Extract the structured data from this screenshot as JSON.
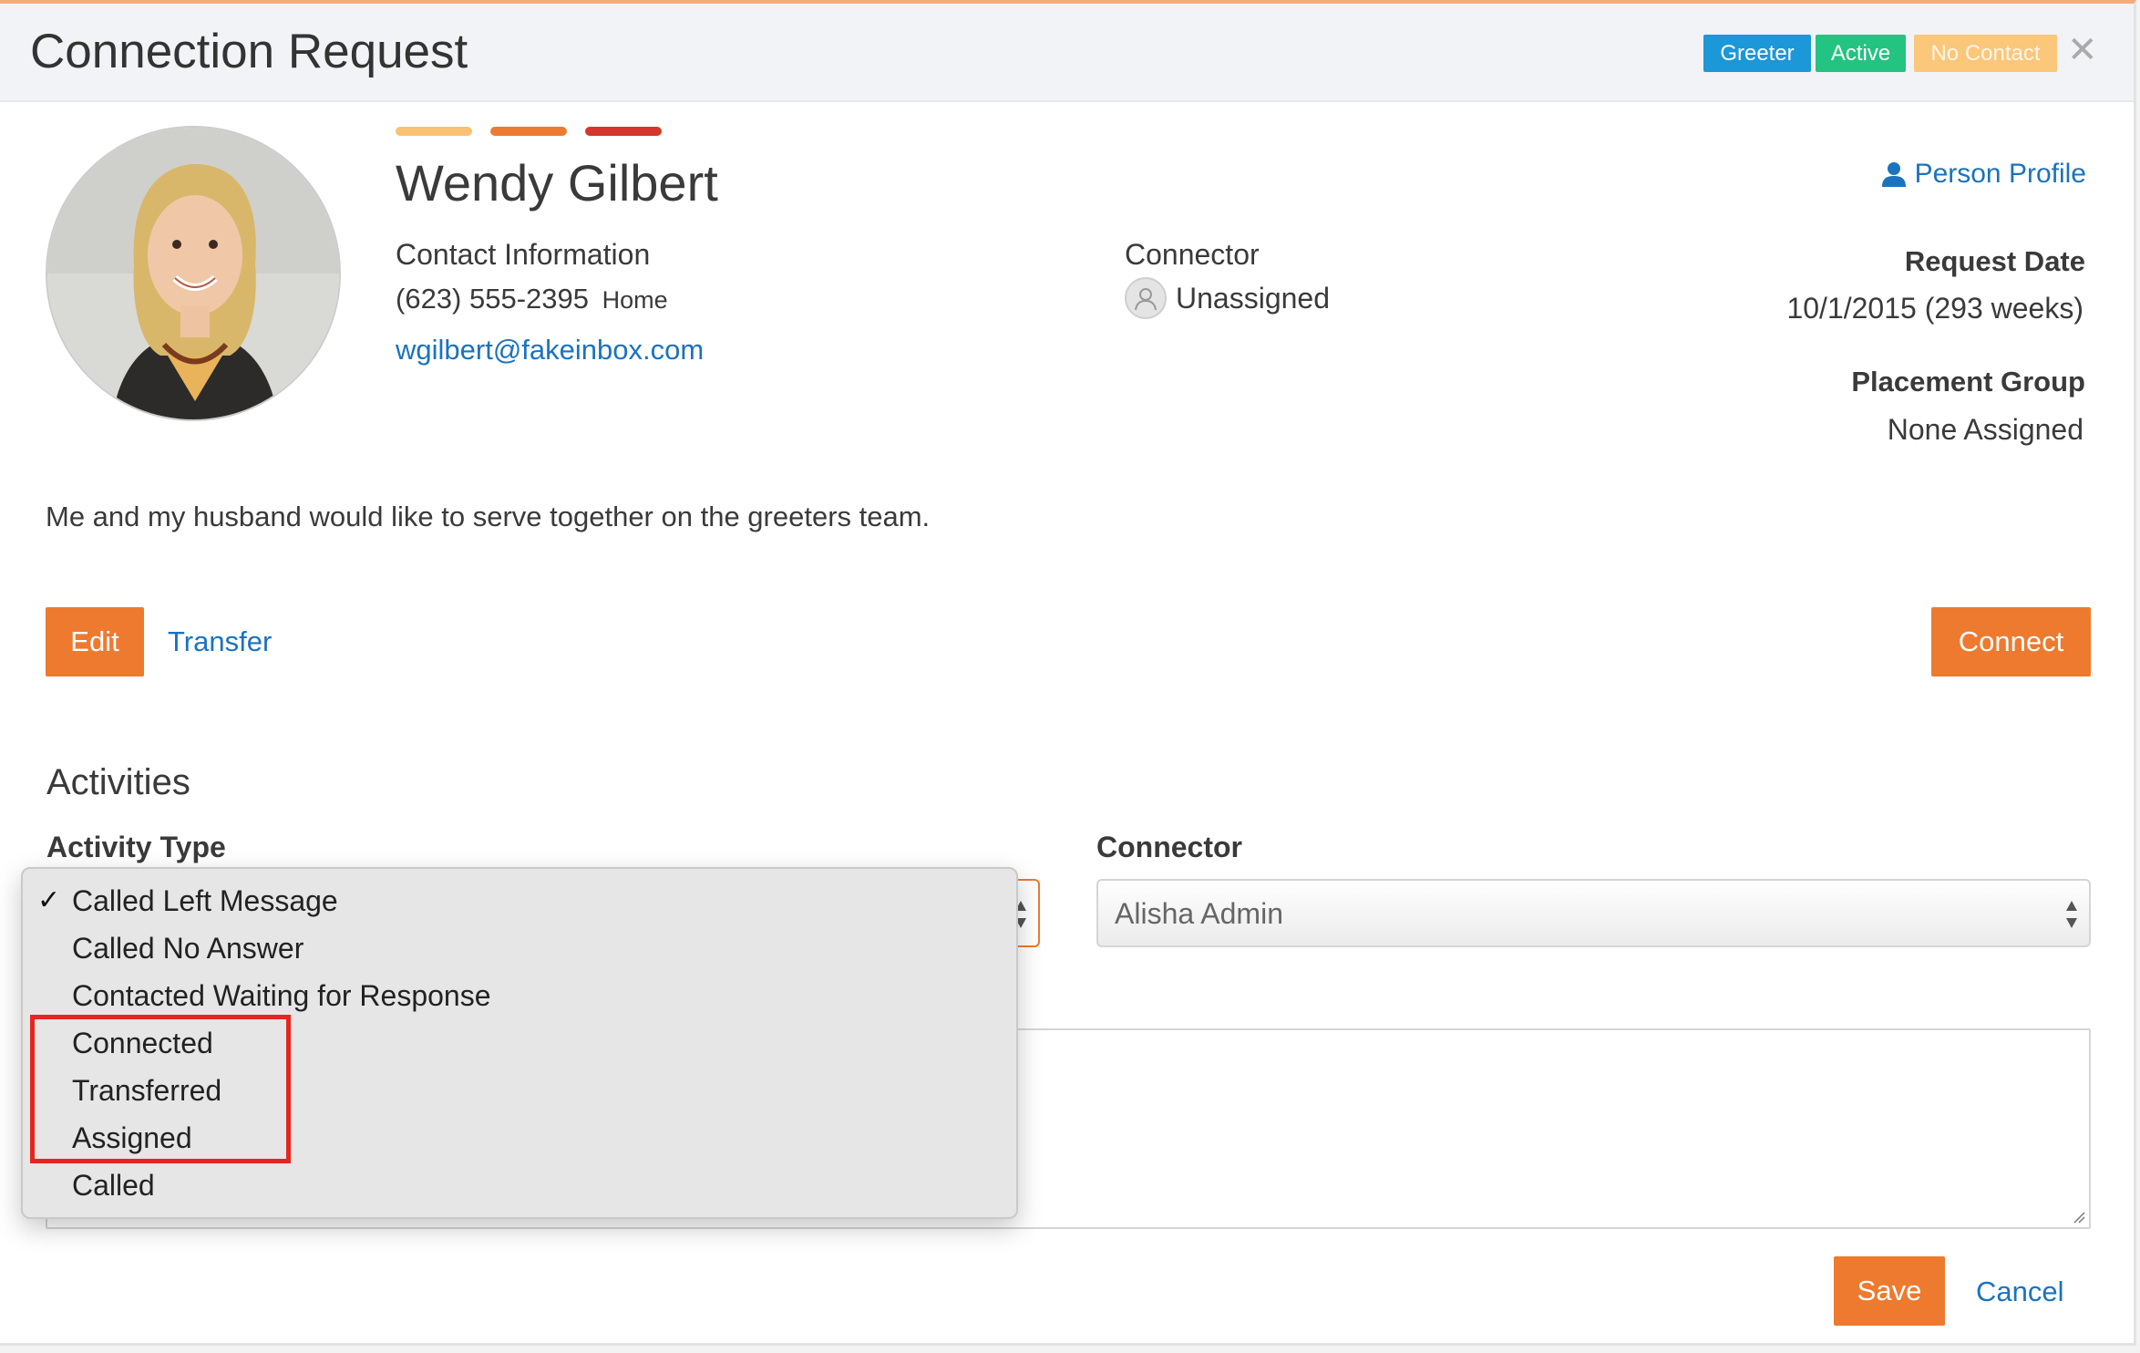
{
  "header": {
    "title": "Connection Request",
    "badges": {
      "greeter": "Greeter",
      "active": "Active",
      "no_contact": "No Contact"
    },
    "close_glyph": "✕"
  },
  "person": {
    "name": "Wendy Gilbert",
    "contact_label": "Contact Information",
    "phone": "(623) 555-2395",
    "phone_type": "Home",
    "email": "wgilbert@fakeinbox.com",
    "comment": "Me and my husband would like to serve together on the greeters team."
  },
  "connector": {
    "label": "Connector",
    "value": "Unassigned"
  },
  "profile_link": "Person Profile",
  "request_date": {
    "label": "Request Date",
    "value": "10/1/2015 (293 weeks)"
  },
  "placement_group": {
    "label": "Placement Group",
    "value": "None Assigned"
  },
  "actions": {
    "edit": "Edit",
    "transfer": "Transfer",
    "connect": "Connect"
  },
  "activities": {
    "title": "Activities",
    "activity_type_label": "Activity Type",
    "connector_label": "Connector",
    "connector_value": "Alisha Admin",
    "options": [
      "Called Left Message",
      "Called No Answer",
      "Contacted Waiting for Response",
      "Connected",
      "Transferred",
      "Assigned",
      "Called"
    ],
    "selected": "Called Left Message",
    "check_glyph": "✓"
  },
  "footer": {
    "save": "Save",
    "cancel": "Cancel"
  },
  "colors": {
    "accent_orange": "#ee7a2f",
    "link_blue": "#1b73bd",
    "badge_greeter": "#1c97d8",
    "badge_active": "#23c381",
    "badge_no_contact": "#fbc77a",
    "annotation_red": "#e5261f"
  },
  "icons": {
    "profile": "user-icon",
    "connector_avatar": "person-placeholder-icon",
    "close": "close-icon"
  }
}
